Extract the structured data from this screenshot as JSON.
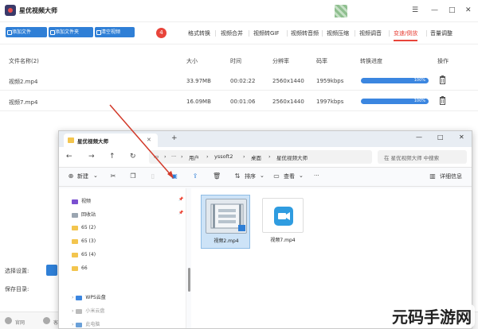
{
  "app": {
    "title": "星优视频大师",
    "window_controls": [
      "☰",
      "—",
      "□",
      "✕"
    ]
  },
  "toolbar": {
    "buttons": [
      "添加文件",
      "添加文件夹",
      "清空视频"
    ],
    "badge": "4"
  },
  "tabs": [
    {
      "label": "格式转换",
      "active": false
    },
    {
      "label": "视频合并",
      "active": false
    },
    {
      "label": "视频转GIF",
      "active": false
    },
    {
      "label": "视频转音频",
      "active": false
    },
    {
      "label": "视频压缩",
      "active": false
    },
    {
      "label": "视频调音",
      "active": false
    },
    {
      "label": "变速/倒放",
      "active": true
    },
    {
      "label": "音量调整",
      "active": false
    }
  ],
  "table": {
    "headers": [
      "文件名称(2)",
      "大小",
      "时间",
      "分辨率",
      "码率",
      "转换进度",
      "操作"
    ],
    "rows": [
      {
        "name": "视频2.mp4",
        "size": "33.97MB",
        "time": "00:02:22",
        "resolution": "2560x1440",
        "bitrate": "1959kbps",
        "progress": "100%"
      },
      {
        "name": "视频7.mp4",
        "size": "16.09MB",
        "time": "00:01:06",
        "resolution": "2560x1440",
        "bitrate": "1997kbps",
        "progress": "100%"
      }
    ]
  },
  "settings": {
    "select_label": "选择设置:",
    "save_dir_label": "保存目录:"
  },
  "bottom": {
    "items": [
      "官网",
      "客服"
    ]
  },
  "explorer": {
    "tab_title": "星优视频大师",
    "breadcrumbs": [
      "用户",
      "yssoft2",
      "桌面",
      "星优视频大师"
    ],
    "search_placeholder": "在 星优视频大师 中搜索",
    "commands": {
      "new": "新建",
      "sort": "排序",
      "view": "查看",
      "more": "···",
      "details": "详细信息"
    },
    "sidebar": [
      {
        "label": "视频",
        "pinned": true
      },
      {
        "label": "回收站",
        "pinned": true
      },
      {
        "label": "65 (2)"
      },
      {
        "label": "65 (3)"
      },
      {
        "label": "65 (4)"
      },
      {
        "label": "66"
      },
      {
        "label": "WPS云盘"
      },
      {
        "label": "小米云盘"
      },
      {
        "label": "此电脑"
      }
    ],
    "files": [
      {
        "name": "视频2.mp4",
        "selected": true
      },
      {
        "name": "视频7.mp4",
        "selected": false
      }
    ]
  },
  "watermark": "元码手游网"
}
